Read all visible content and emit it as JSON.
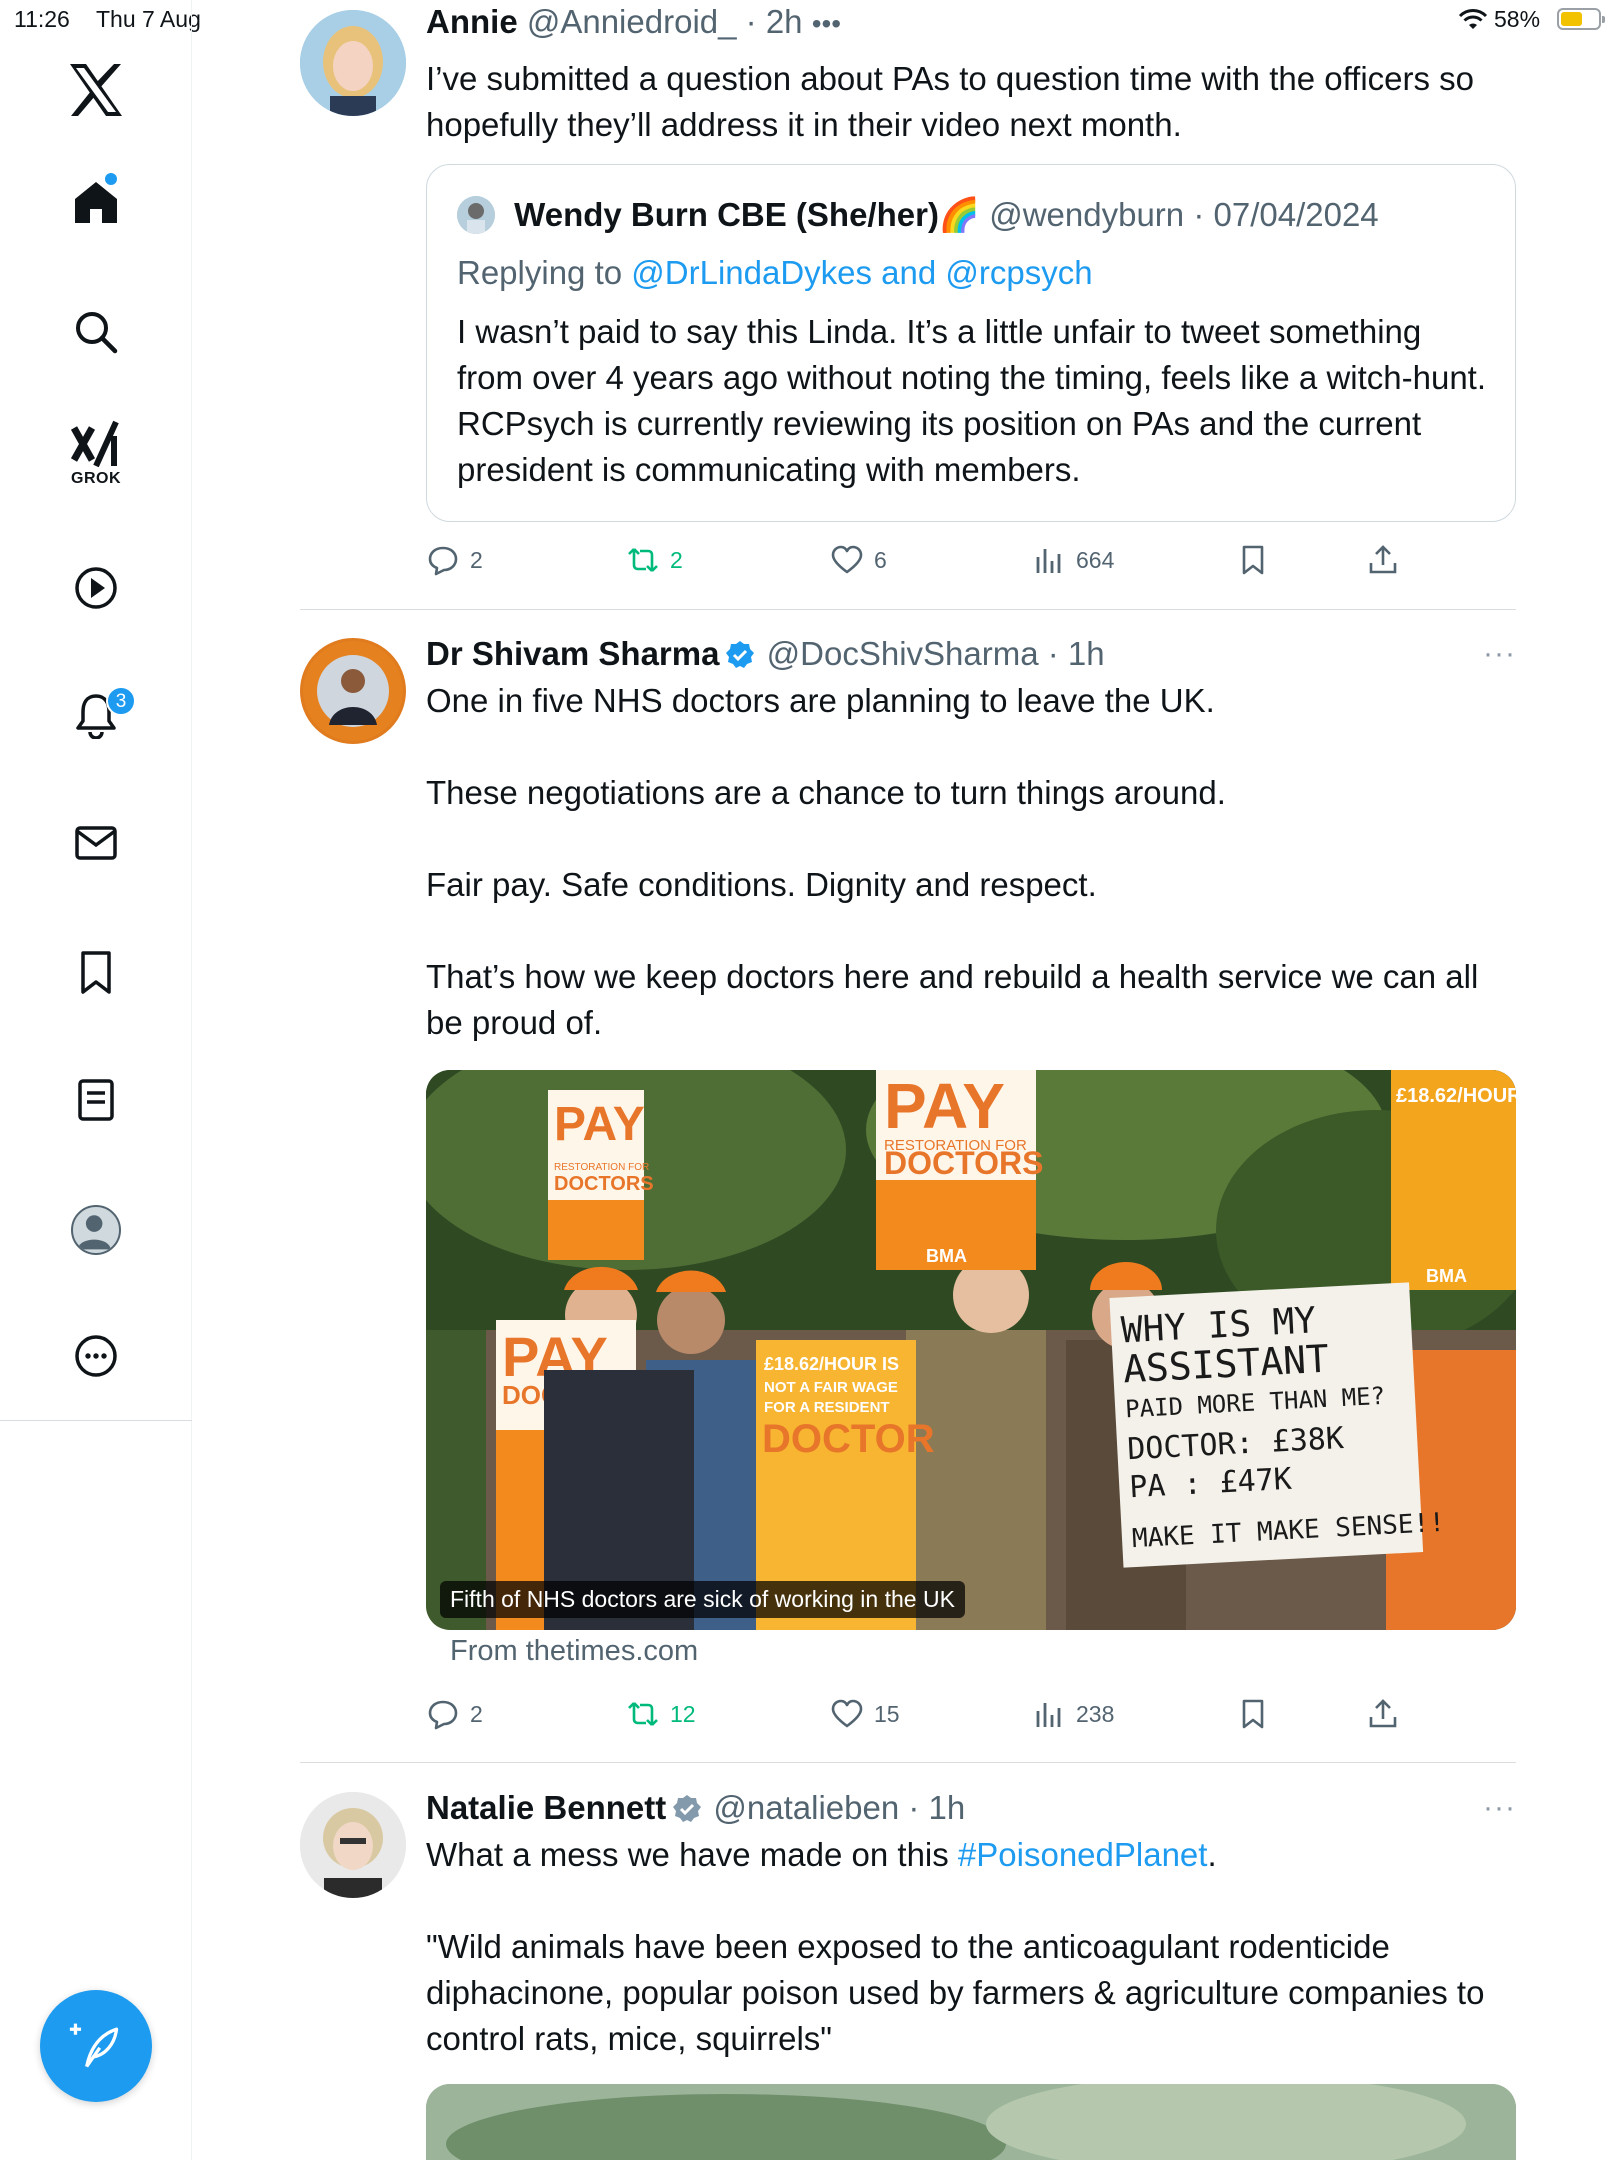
{
  "status_bar": {
    "time": "11:26",
    "date": "Thu 7 Aug",
    "battery_percent": "58%",
    "battery_level": 0.58
  },
  "sidebar": {
    "grok_label": "GROK",
    "notification_count": "3"
  },
  "colors": {
    "accent": "#1d9bf0",
    "retweet_green": "#00ba7c",
    "muted": "#536471"
  },
  "tweets": [
    {
      "name": "Annie",
      "handle": "@Anniedroid_",
      "time": "· 2h",
      "text": "I’ve submitted a question about PAs to question time with the officers so hopefully they’ll address it in their video next month.",
      "quote": {
        "name": "Wendy Burn CBE (She/her)🌈",
        "handle": "@wendyburn",
        "date": "· 07/04/2024",
        "reply_prefix": "Replying to ",
        "reply_to": "@DrLindaDykes and @rcpsych",
        "text": "I wasn’t paid to say this Linda. It’s a little unfair to tweet something from over 4 years ago without noting the timing, feels like a witch-hunt. RCPsych is currently reviewing its position on PAs and the current president is communicating with members."
      },
      "stats": {
        "replies": "2",
        "reposts": "2",
        "likes": "6",
        "views": "664"
      }
    },
    {
      "name": "Dr Shivam Sharma",
      "handle": "@DocShivSharma",
      "time": "· 1h",
      "text": "One in five NHS doctors are planning to leave the UK.\n\nThese negotiations are a chance to turn things around.\n\nFair pay. Safe conditions. Dignity and respect.\n\nThat’s how we keep doctors here and rebuild a health service we can all be proud of.",
      "media_caption": "Fifth of NHS doctors are sick of working in the UK",
      "source": "From thetimes.com",
      "stats": {
        "replies": "2",
        "reposts": "12",
        "likes": "15",
        "views": "238"
      }
    },
    {
      "name": "Natalie Bennett",
      "handle": "@natalieben",
      "time": "· 1h",
      "text_before": "What a mess we have made on this ",
      "hashtag": "#PoisonedPlanet",
      "text_after": ".",
      "text2": "\"Wild animals have been exposed to the anticoagulant rodenticide diphacinone, popular poison used by farmers & agriculture companies to control rats, mice, squirrels\""
    }
  ],
  "placard_text": {
    "pay": "PAY",
    "restoration": "RESTORATION FOR",
    "doctors": "DOCTORS",
    "bma": "BMA",
    "wage_line1": "£18.62/HOUR IS",
    "wage_line2": "NOT A FAIR WAGE",
    "wage_line3": "FOR A RESIDENT",
    "wage_line4": "DOCTOR",
    "hand_line1": "WHY IS MY",
    "hand_line2": "ASSISTANT",
    "hand_line3": "PAID MORE THAN ME?",
    "hand_line4": "DOCTOR: £38K",
    "hand_line5": "PA : £47K",
    "hand_line6": "MAKE IT MAKE SENSE!!"
  }
}
